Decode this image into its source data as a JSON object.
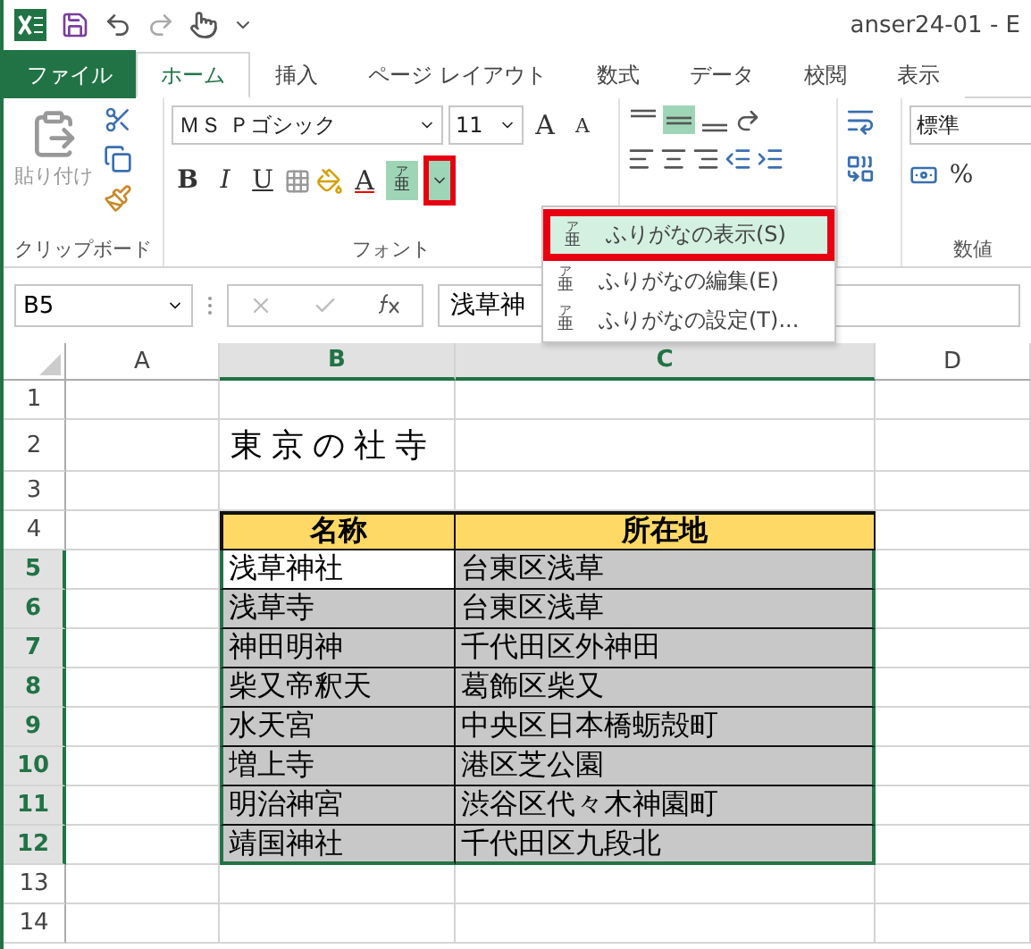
{
  "title_bar": {
    "title": "anser24-01 - E"
  },
  "ribbon_tabs": [
    {
      "label": "ファイル",
      "kind": "file",
      "selected": false
    },
    {
      "label": "ホーム",
      "kind": "tab",
      "selected": true
    },
    {
      "label": "挿入",
      "kind": "tab",
      "selected": false
    },
    {
      "label": "ページ レイアウト",
      "kind": "tab",
      "selected": false
    },
    {
      "label": "数式",
      "kind": "tab",
      "selected": false
    },
    {
      "label": "データ",
      "kind": "tab",
      "selected": false
    },
    {
      "label": "校閲",
      "kind": "tab",
      "selected": false
    },
    {
      "label": "表示",
      "kind": "tab",
      "selected": false
    }
  ],
  "ribbon": {
    "paste_label": "貼り付け",
    "font_name": "ＭＳ Ｐゴシック",
    "font_size": "11",
    "grow_font": "A",
    "shrink_font": "A",
    "bold": "B",
    "italic": "I",
    "underline": "U",
    "font_color": "A",
    "furigana_button": {
      "ruby": "ア",
      "base": "亜",
      "highlighted": false
    },
    "furigana_dropdown": {
      "highlighted": true
    },
    "number_format": "標準",
    "percent": "%",
    "groups": [
      {
        "label": "クリップボード"
      },
      {
        "label": "フォント"
      },
      {
        "label": "数値"
      }
    ]
  },
  "furigana_menu": {
    "items": [
      {
        "label": "ふりがなの表示(S)",
        "ruby": "ア",
        "base": "亜",
        "selected": true,
        "highlighted": true
      },
      {
        "label": "ふりがなの編集(E)",
        "ruby": "ア",
        "base": "亜",
        "selected": false,
        "highlighted": false
      },
      {
        "label": "ふりがなの設定(T)...",
        "ruby": "ア",
        "base": "亜",
        "selected": false,
        "highlighted": false
      }
    ]
  },
  "formula_bar": {
    "name_box": "B5",
    "content": "浅草神"
  },
  "sheet": {
    "columns": [
      {
        "label": "A",
        "selected": false
      },
      {
        "label": "B",
        "selected": true
      },
      {
        "label": "C",
        "selected": true
      },
      {
        "label": "D",
        "selected": false
      }
    ],
    "rows": [
      {
        "number": "1",
        "kind": "blank",
        "selected": false
      },
      {
        "number": "2",
        "kind": "title",
        "selected": false,
        "title": "東京の社寺"
      },
      {
        "number": "3",
        "kind": "blank",
        "selected": false
      },
      {
        "number": "4",
        "kind": "header",
        "selected": false,
        "cells": [
          "名称",
          "所在地"
        ]
      },
      {
        "number": "5",
        "kind": "data",
        "selected": true,
        "active": true,
        "cells": [
          "浅草神社",
          "台東区浅草"
        ]
      },
      {
        "number": "6",
        "kind": "data",
        "selected": true,
        "active": false,
        "cells": [
          "浅草寺",
          "台東区浅草"
        ]
      },
      {
        "number": "7",
        "kind": "data",
        "selected": true,
        "active": false,
        "cells": [
          "神田明神",
          "千代田区外神田"
        ]
      },
      {
        "number": "8",
        "kind": "data",
        "selected": true,
        "active": false,
        "cells": [
          "柴又帝釈天",
          "葛飾区柴又"
        ]
      },
      {
        "number": "9",
        "kind": "data",
        "selected": true,
        "active": false,
        "cells": [
          "水天宮",
          "中央区日本橋蛎殻町"
        ]
      },
      {
        "number": "10",
        "kind": "data",
        "selected": true,
        "active": false,
        "cells": [
          "増上寺",
          "港区芝公園"
        ]
      },
      {
        "number": "11",
        "kind": "data",
        "selected": true,
        "active": false,
        "cells": [
          "明治神宮",
          "渋谷区代々木神園町"
        ]
      },
      {
        "number": "12",
        "kind": "data",
        "selected": true,
        "active": false,
        "cells": [
          "靖国神社",
          "千代田区九段北"
        ]
      },
      {
        "number": "13",
        "kind": "blank",
        "selected": false
      },
      {
        "number": "14",
        "kind": "blank",
        "selected": false
      }
    ]
  }
}
